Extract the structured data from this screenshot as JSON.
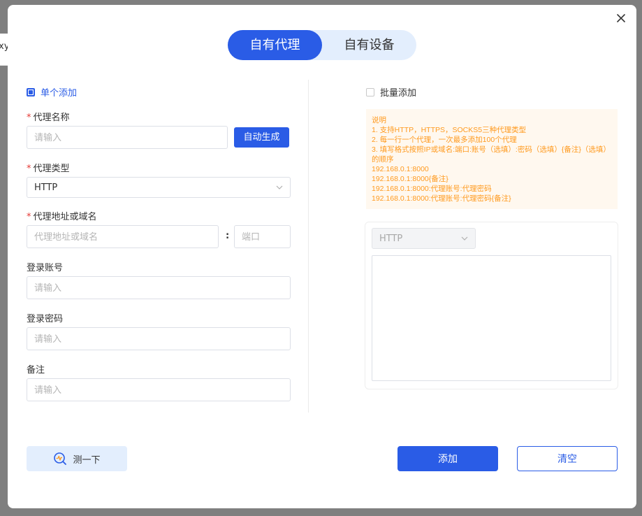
{
  "background": {
    "underlying_text": "xy"
  },
  "tabs": [
    {
      "label": "自有代理",
      "active": true
    },
    {
      "label": "自有设备",
      "active": false
    }
  ],
  "single": {
    "checkbox_label": "单个添加",
    "checked": true,
    "proxy_name": {
      "label": "代理名称",
      "placeholder": "请输入",
      "auto_button": "自动生成"
    },
    "proxy_type": {
      "label": "代理类型",
      "value": "HTTP"
    },
    "proxy_address": {
      "label": "代理地址或域名",
      "placeholder": "代理地址或域名",
      "separator": ":",
      "port_placeholder": "端口"
    },
    "login_account": {
      "label": "登录账号",
      "placeholder": "请输入"
    },
    "login_password": {
      "label": "登录密码",
      "placeholder": "请输入"
    },
    "remark": {
      "label": "备注",
      "placeholder": "请输入"
    },
    "required_mark": "*"
  },
  "batch": {
    "checkbox_label": "批量添加",
    "checked": false,
    "instructions": [
      "说明",
      "1. 支持HTTP，HTTPS，SOCKS5三种代理类型",
      "2. 每一行一个代理，一次最多添加100个代理",
      "3. 填写格式按照IP或域名:端口:账号（选填）:密码（选填）{备注}（选填）的顺序",
      "192.168.0.1:8000",
      "192.168.0.1:8000{备注}",
      "192.168.0.1:8000:代理账号:代理密码",
      "192.168.0.1:8000:代理账号:代理密码{备注}"
    ],
    "type_value": "HTTP"
  },
  "footer": {
    "test_label": "测一下",
    "add_label": "添加",
    "clear_label": "清空"
  },
  "colors": {
    "primary": "#2a5ce6",
    "tab_bg": "#e3eefd",
    "note_text": "#ff9a1f",
    "note_bg": "#fff8ef",
    "required": "#e53935"
  }
}
